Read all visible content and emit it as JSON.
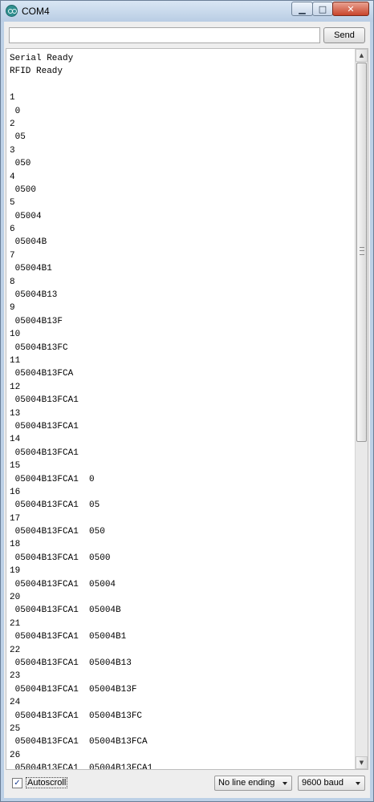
{
  "window": {
    "title": "COM4"
  },
  "title_buttons": {
    "minimize": "▁",
    "maximize": "□",
    "close": "✕"
  },
  "send_row": {
    "input_value": "",
    "send_label": "Send"
  },
  "serial_output": [
    "Serial Ready",
    "RFID Ready",
    "",
    "1",
    " 0",
    "2",
    " 05",
    "3",
    " 050",
    "4",
    " 0500",
    "5",
    " 05004",
    "6",
    " 05004B",
    "7",
    " 05004B1",
    "8",
    " 05004B13",
    "9",
    " 05004B13F",
    "10",
    " 05004B13FC",
    "11",
    " 05004B13FCA",
    "12",
    " 05004B13FCA1",
    "13",
    " 05004B13FCA1",
    "14",
    " 05004B13FCA1",
    "15",
    " 05004B13FCA1  0",
    "16",
    " 05004B13FCA1  05",
    "17",
    " 05004B13FCA1  050",
    "18",
    " 05004B13FCA1  0500",
    "19",
    " 05004B13FCA1  05004",
    "20",
    " 05004B13FCA1  05004B",
    "21",
    " 05004B13FCA1  05004B1",
    "22",
    " 05004B13FCA1  05004B13",
    "23",
    " 05004B13FCA1  05004B13F",
    "24",
    " 05004B13FCA1  05004B13FC",
    "25",
    " 05004B13FCA1  05004B13FCA",
    "26",
    " 05004B13FCA1  05004B13FCA1"
  ],
  "scrollbar": {
    "up_arrow": "▲",
    "down_arrow": "▼"
  },
  "footer": {
    "autoscroll_label": "Autoscroll",
    "autoscroll_checked": true,
    "autoscroll_mark": "✓",
    "line_ending": "No line ending",
    "baud": "9600 baud"
  },
  "icons": {
    "app": "arduino-icon",
    "dropdown": "chevron-down-icon",
    "checkbox": "checkmark-icon"
  }
}
